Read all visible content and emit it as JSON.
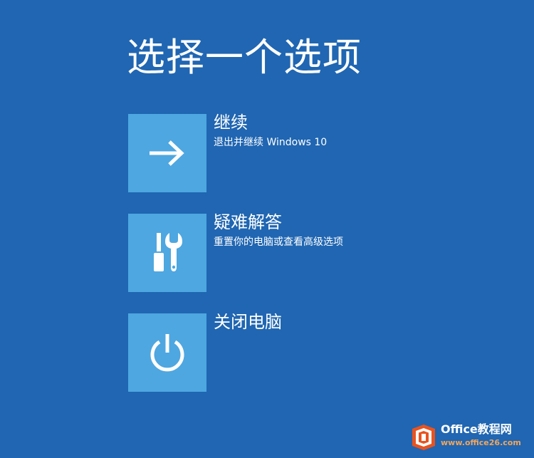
{
  "page": {
    "title": "选择一个选项",
    "background_color": "#2066b2",
    "tile_color": "#4ea7e0"
  },
  "options": [
    {
      "title": "继续",
      "description": "退出并继续 Windows 10",
      "icon": "arrow-right-icon"
    },
    {
      "title": "疑难解答",
      "description": "重置你的电脑或查看高级选项",
      "icon": "tools-icon"
    },
    {
      "title": "关闭电脑",
      "description": "",
      "icon": "power-icon"
    }
  ],
  "watermark": {
    "name": "Office教程网",
    "url": "www.office26.com",
    "logo_icon": "office-logo-icon",
    "logo_color": "#e8531f"
  }
}
